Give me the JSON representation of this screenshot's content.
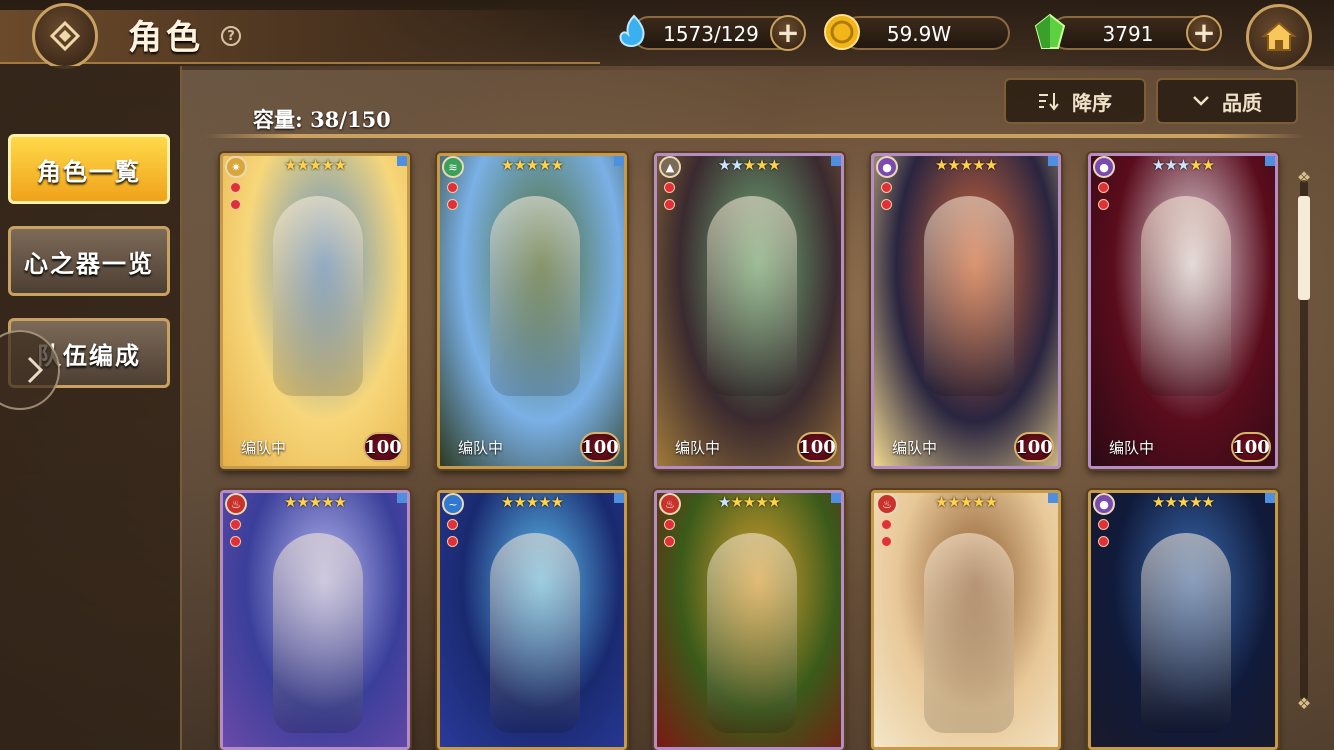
{
  "header": {
    "title": "角色",
    "help_label": "?",
    "currencies": [
      {
        "icon": "stamina-droplet-icon",
        "value": "1573/129",
        "has_plus": true
      },
      {
        "icon": "gold-coin-icon",
        "value": "59.9W",
        "has_plus": false
      },
      {
        "icon": "green-crystal-icon",
        "value": "3791",
        "has_plus": true
      }
    ],
    "plus_label": "+"
  },
  "sidebar": {
    "items": [
      {
        "label": "角色一覧",
        "active": true
      },
      {
        "label": "心之器一览",
        "active": false
      },
      {
        "label": "队伍编成",
        "active": false
      }
    ]
  },
  "toolbar": {
    "capacity_label": "容量: 38/150",
    "sort_label": "降序",
    "filter_label": "品质"
  },
  "cards": [
    {
      "stars": 5,
      "silver": 0,
      "element": "light",
      "elem_color": "#d9a63a",
      "status": "编队中",
      "level": "100",
      "palette": [
        "#f7d77a",
        "#5d8fc4",
        "#e6b04a"
      ],
      "frame": "#c59a4a"
    },
    {
      "stars": 5,
      "silver": 0,
      "element": "wind",
      "elem_color": "#3aa05a",
      "status": "编队中",
      "level": "100",
      "palette": [
        "#7ab0e6",
        "#4b6b2f",
        "#2c3b22"
      ],
      "frame": "#c59a4a"
    },
    {
      "stars": 5,
      "silver": 2,
      "element": "earth",
      "elem_color": "#7a6a58",
      "status": "编队中",
      "level": "100",
      "palette": [
        "#3b2a2f",
        "#6fae7a",
        "#a07a3a"
      ],
      "frame": "#b48cc8"
    },
    {
      "stars": 5,
      "silver": 0,
      "element": "dark",
      "elem_color": "#7a4ab0",
      "status": "编队中",
      "level": "100",
      "palette": [
        "#2a2540",
        "#d86a3a",
        "#f0d890"
      ],
      "frame": "#b48cc8"
    },
    {
      "stars": 5,
      "silver": 3,
      "element": "dark",
      "elem_color": "#7a4ab0",
      "status": "编队中",
      "level": "100",
      "palette": [
        "#5a0c1c",
        "#e8e0e8",
        "#2a0a14"
      ],
      "frame": "#b48cc8"
    },
    {
      "stars": 5,
      "silver": 0,
      "element": "fire",
      "elem_color": "#c8322a",
      "status": "",
      "level": "",
      "palette": [
        "#3a3f9a",
        "#b6b8f0",
        "#6a4aa8"
      ],
      "frame": "#b48cc8"
    },
    {
      "stars": 5,
      "silver": 0,
      "element": "water",
      "elem_color": "#2f7ad0",
      "status": "",
      "level": "",
      "palette": [
        "#1a2a70",
        "#5ec0f0",
        "#2a3a9a"
      ],
      "frame": "#c59a4a"
    },
    {
      "stars": 5,
      "silver": 1,
      "element": "fire",
      "elem_color": "#c8322a",
      "status": "",
      "level": "",
      "palette": [
        "#3a5a1a",
        "#d8a030",
        "#7a1a12"
      ],
      "frame": "#b48cc8"
    },
    {
      "stars": 5,
      "silver": 0,
      "element": "fire",
      "elem_color": "#c8322a",
      "status": "",
      "level": "",
      "palette": [
        "#e8c898",
        "#8a5a30",
        "#f4e6c8"
      ],
      "frame": "#c59a4a"
    },
    {
      "stars": 5,
      "silver": 0,
      "element": "dark",
      "elem_color": "#7a4ab0",
      "status": "",
      "level": "",
      "palette": [
        "#101a3a",
        "#3a6ab0",
        "#1a1a2a"
      ],
      "frame": "#c59a4a"
    }
  ]
}
